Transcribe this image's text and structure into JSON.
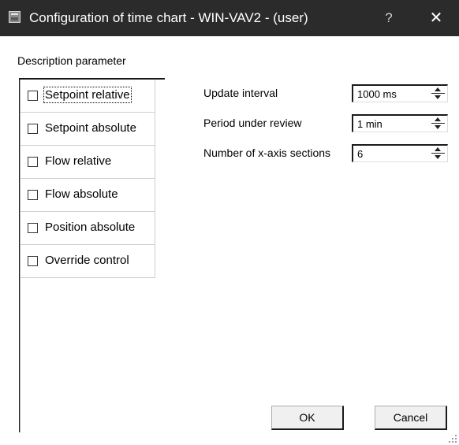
{
  "window": {
    "title": "Configuration of time chart - WIN-VAV2 - (user)",
    "help_label": "?",
    "close_label": "✕",
    "icon": "app-icon"
  },
  "group": {
    "label": "Description parameter"
  },
  "tabs": [
    {
      "label": "Setpoint relative",
      "checked": false,
      "active": true
    },
    {
      "label": "Setpoint absolute",
      "checked": false,
      "active": false
    },
    {
      "label": "Flow relative",
      "checked": false,
      "active": false
    },
    {
      "label": "Flow absolute",
      "checked": false,
      "active": false
    },
    {
      "label": "Position absolute",
      "checked": false,
      "active": false
    },
    {
      "label": "Override control",
      "checked": false,
      "active": false
    }
  ],
  "params": {
    "update_interval": {
      "label": "Update interval",
      "value": "1000 ms"
    },
    "period": {
      "label": "Period under review",
      "value": "1 min"
    },
    "sections": {
      "label": "Number of x-axis sections",
      "value": "6"
    }
  },
  "buttons": {
    "ok": "OK",
    "cancel": "Cancel"
  }
}
